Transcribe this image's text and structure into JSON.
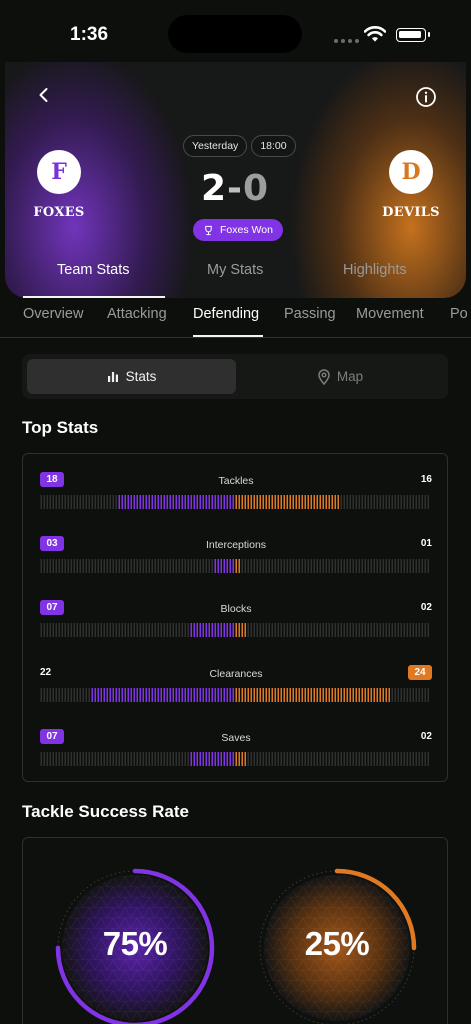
{
  "status_bar": {
    "time": "1:36"
  },
  "match": {
    "home": {
      "initial": "F",
      "name": "FOXES"
    },
    "away": {
      "initial": "D",
      "name": "DEVILS"
    },
    "day": "Yesterday",
    "kickoff": "18:00",
    "home_score": "2",
    "separator": "-",
    "away_score": "0",
    "result": "Foxes Won"
  },
  "main_tabs": [
    {
      "label": "Team Stats",
      "active": true
    },
    {
      "label": "My Stats",
      "active": false
    },
    {
      "label": "Highlights",
      "active": false
    }
  ],
  "sub_tabs": [
    {
      "label": "Overview",
      "active": false
    },
    {
      "label": "Attacking",
      "active": false
    },
    {
      "label": "Defending",
      "active": true
    },
    {
      "label": "Passing",
      "active": false
    },
    {
      "label": "Movement",
      "active": false
    },
    {
      "label": "Po",
      "active": false
    }
  ],
  "segment": {
    "stats_label": "Stats",
    "map_label": "Map",
    "selected": "Stats"
  },
  "top_stats": {
    "title": "Top Stats",
    "rows": [
      {
        "label": "Tackles",
        "home": "18",
        "away": "16",
        "home_value": 18,
        "away_value": 16,
        "leader": "home"
      },
      {
        "label": "Interceptions",
        "home": "03",
        "away": "01",
        "home_value": 3,
        "away_value": 1,
        "leader": "home"
      },
      {
        "label": "Blocks",
        "home": "07",
        "away": "02",
        "home_value": 7,
        "away_value": 2,
        "leader": "home"
      },
      {
        "label": "Clearances",
        "home": "22",
        "away": "24",
        "home_value": 22,
        "away_value": 24,
        "leader": "away"
      },
      {
        "label": "Saves",
        "home": "07",
        "away": "02",
        "home_value": 7,
        "away_value": 2,
        "leader": "home"
      }
    ]
  },
  "tackle_success": {
    "title": "Tackle Success Rate",
    "home_label": "75%",
    "away_label": "25%",
    "home_fraction": 0.75,
    "away_fraction": 0.25
  },
  "colors": {
    "home": "#8133e6",
    "away": "#df7a23",
    "inactive_tick": "#2f302f"
  }
}
